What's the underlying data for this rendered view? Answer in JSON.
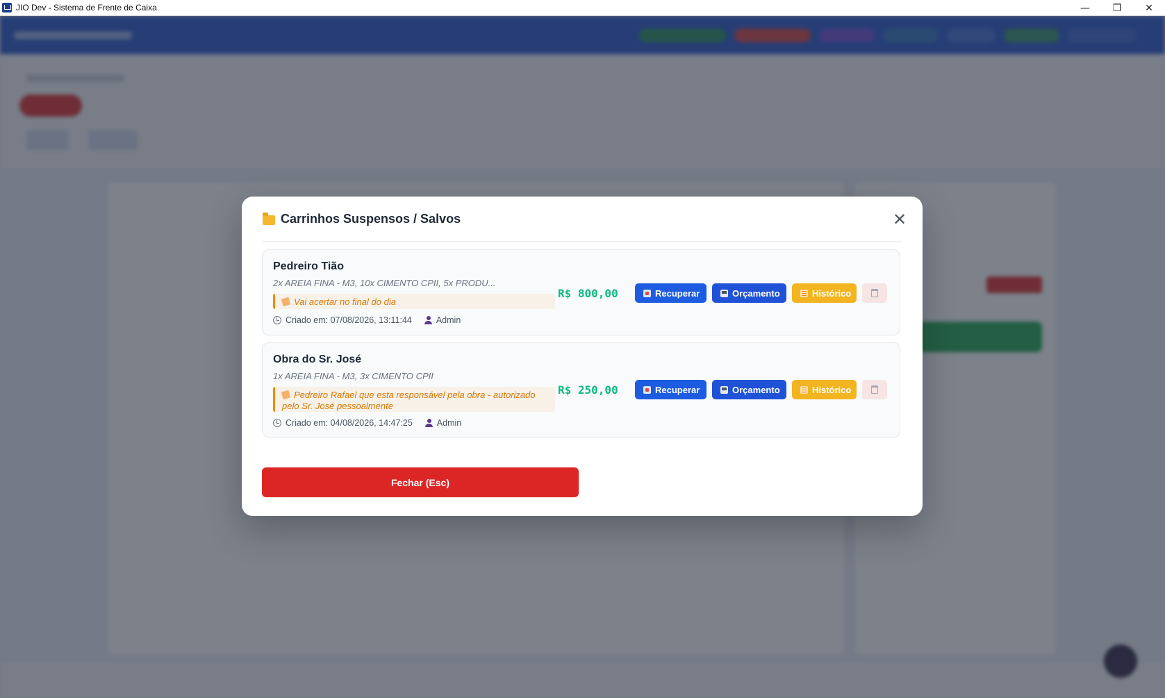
{
  "window": {
    "title": "JIO Dev - Sistema de Frente de Caixa",
    "minimize_glyph": "—",
    "maximize_glyph": "❐",
    "close_glyph": "✕"
  },
  "modal": {
    "title": "Carrinhos Suspensos / Salvos",
    "close_glyph": "✕",
    "close_button_label": "Fechar (Esc)",
    "carts": [
      {
        "name": "Pedreiro Tião",
        "items": "2x AREIA FINA - M3, 10x CIMENTO CPII, 5x PRODU...",
        "note": "Vai acertar no final do dia",
        "created": "Criado em: 07/08/2026, 13:11:44",
        "user": "Admin",
        "total": "R$ 800,00"
      },
      {
        "name": "Obra do Sr. José",
        "items": "1x AREIA FINA - M3, 3x CIMENTO CPII",
        "note": "Pedreiro Rafael que esta responsável pela obra - autorizado pelo Sr. José pessoalmente",
        "created": "Criado em: 04/08/2026, 14:47:25",
        "user": "Admin",
        "total": "R$ 250,00"
      }
    ],
    "buttons": {
      "recover": "Recuperar",
      "quote": "Orçamento",
      "history": "Histórico"
    }
  },
  "colors": {
    "primary": "#1d5ce0",
    "danger": "#dc2626",
    "success_total": "#10b981",
    "warning": "#f2b420",
    "note_accent": "#f08a00"
  },
  "icons": {
    "folder": "folder-icon",
    "close": "close-icon",
    "note": "note-icon",
    "clock": "clock-icon",
    "user": "user-icon",
    "recover": "recover-icon",
    "quote": "printer-icon",
    "history": "history-icon",
    "delete": "trash-icon"
  }
}
